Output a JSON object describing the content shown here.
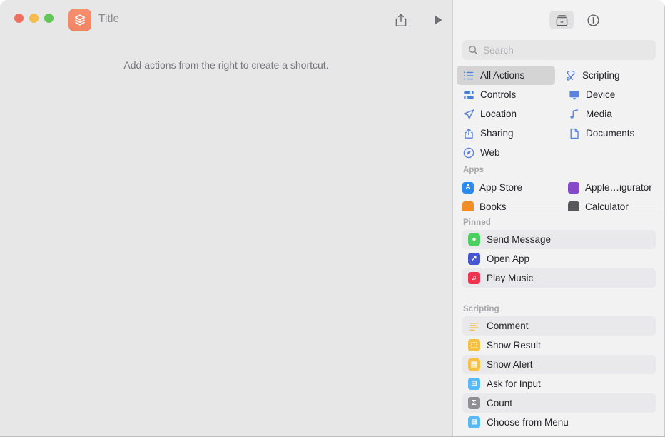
{
  "window": {
    "traffic_lights": [
      {
        "name": "close",
        "color": "#ef6f62"
      },
      {
        "name": "minimize",
        "color": "#f4bc4e"
      },
      {
        "name": "maximize",
        "color": "#62c756"
      }
    ]
  },
  "editor": {
    "app_icon_name": "shortcuts-app-icon",
    "title": "Title",
    "share_label": "share-icon",
    "run_label": "play-icon",
    "empty_hint": "Add actions from the right to create a shortcut."
  },
  "library": {
    "toolbar": {
      "add_action_label": "action-library-icon",
      "info_label": "info-icon"
    },
    "search": {
      "value": "",
      "placeholder": "Search",
      "icon": "search-icon"
    },
    "categories": [
      [
        {
          "label": "All Actions",
          "icon": "list-bullet-icon",
          "selected": true,
          "color": "#4a7fd6"
        },
        {
          "label": "Scripting",
          "icon": "scroll-icon",
          "selected": false,
          "color": "#5b82e0"
        }
      ],
      [
        {
          "label": "Controls",
          "icon": "sliders-icon",
          "selected": false,
          "color": "#4a7fd6"
        },
        {
          "label": "Device",
          "icon": "display-icon",
          "selected": false,
          "color": "#5b82e0"
        }
      ],
      [
        {
          "label": "Location",
          "icon": "paperplane-icon",
          "selected": false,
          "color": "#5b82e0"
        },
        {
          "label": "Media",
          "icon": "music-note-icon",
          "selected": false,
          "color": "#5b82e0"
        }
      ],
      [
        {
          "label": "Sharing",
          "icon": "share-up-icon",
          "selected": false,
          "color": "#5b82e0"
        },
        {
          "label": "Documents",
          "icon": "document-icon",
          "selected": false,
          "color": "#5b82e0"
        }
      ],
      [
        {
          "label": "Web",
          "icon": "compass-icon",
          "selected": false,
          "color": "#5b82e0"
        }
      ]
    ],
    "apps_section": {
      "heading": "Apps",
      "rows": [
        [
          {
            "label": "App Store",
            "icon": "app-store-icon",
            "color": "#2b8af0",
            "glyph": "A"
          },
          {
            "label": "Apple…igurator",
            "icon": "apple-configurator-icon",
            "color": "#8649c9",
            "glyph": ""
          }
        ],
        [
          {
            "label": "Books",
            "icon": "books-icon",
            "color": "#f28c23",
            "glyph": ""
          },
          {
            "label": "Calculator",
            "icon": "calculator-icon",
            "color": "#58585c",
            "glyph": ""
          }
        ]
      ]
    },
    "pinned_section": {
      "heading": "Pinned",
      "items": [
        {
          "label": "Send Message",
          "icon": "message-bubble-icon",
          "color": "#4ad05e",
          "glyph": "●"
        },
        {
          "label": "Open App",
          "icon": "arrow-up-right-icon",
          "color": "#4657cf",
          "glyph": "↗"
        },
        {
          "label": "Play Music",
          "icon": "music-note-icon",
          "color": "#f0344f",
          "glyph": "♫"
        }
      ]
    },
    "scripting_section": {
      "heading": "Scripting",
      "items": [
        {
          "label": "Comment",
          "icon": "comment-lines-icon",
          "color": "#f5c043",
          "glyph": "≡",
          "plain": true
        },
        {
          "label": "Show Result",
          "icon": "show-result-icon",
          "color": "#f5c043",
          "glyph": "⬚"
        },
        {
          "label": "Show Alert",
          "icon": "show-alert-icon",
          "color": "#f5c043",
          "glyph": "▤"
        },
        {
          "label": "Ask for Input",
          "icon": "ask-for-input-icon",
          "color": "#57b9f5",
          "glyph": "⊞"
        },
        {
          "label": "Count",
          "icon": "count-sigma-icon",
          "color": "#8e8e93",
          "glyph": "Σ"
        },
        {
          "label": "Choose from Menu",
          "icon": "choose-from-menu-icon",
          "color": "#57b9f5",
          "glyph": "⊟"
        }
      ]
    }
  }
}
